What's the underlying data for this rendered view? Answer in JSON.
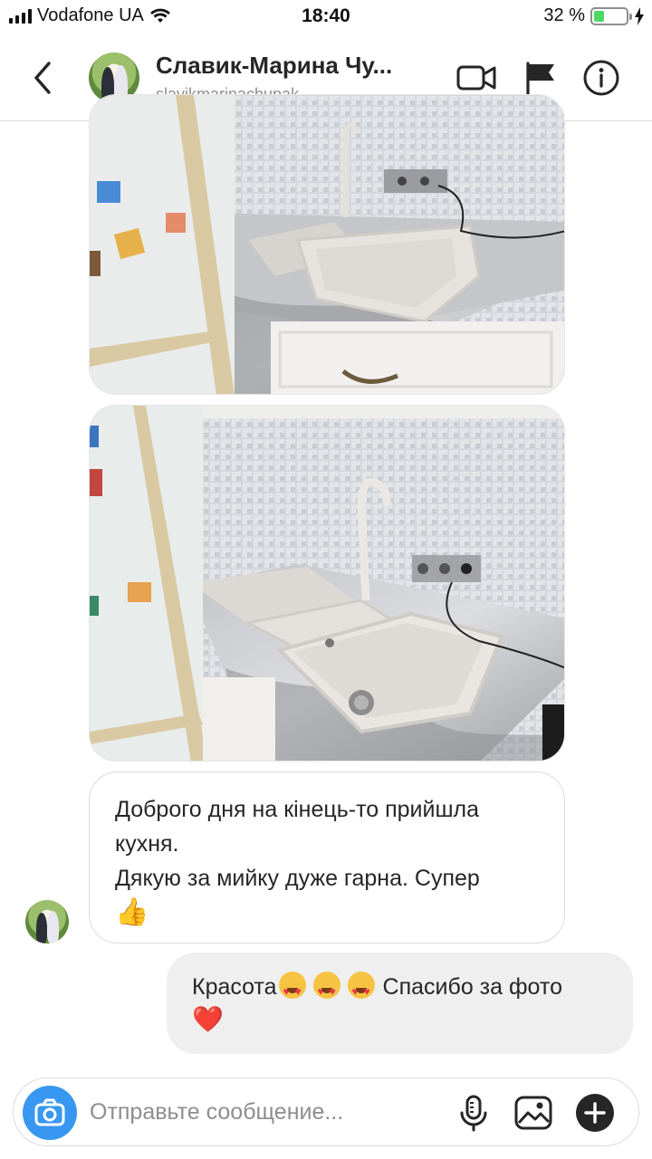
{
  "status_bar": {
    "carrier": "Vodafone UA",
    "time": "18:40",
    "battery_text": "32 %",
    "battery_level": 0.32
  },
  "header": {
    "title": "Славик-Марина Чу...",
    "username": "slavikmarinachupak",
    "icons": [
      "back-icon",
      "video-camera-icon",
      "flag-icon",
      "info-icon"
    ]
  },
  "messages": [
    {
      "type": "photo",
      "from": "them",
      "description_icon": "kitchen-photo"
    },
    {
      "type": "photo",
      "from": "them",
      "description_icon": "kitchen-photo"
    },
    {
      "type": "text",
      "from": "them",
      "line1": "Доброго дня на кінець-то прийшла кухня.",
      "line2": "Дякую за мийку дуже гарна. Супер",
      "emoji": "👍"
    },
    {
      "type": "text",
      "from": "me",
      "text_a": "Красота",
      "text_b": "Спасибо за фото",
      "emoji": "❤️"
    }
  ],
  "composer": {
    "placeholder": "Отправьте сообщение...",
    "icons": [
      "camera-icon",
      "microphone-icon",
      "gallery-icon",
      "plus-icon"
    ]
  },
  "colors": {
    "accent": "#3897f0",
    "outgoing_bubble": "#efefef",
    "border": "#dbdbdb",
    "battery_green": "#4cd964",
    "secondary_text": "#8e8e8e"
  }
}
